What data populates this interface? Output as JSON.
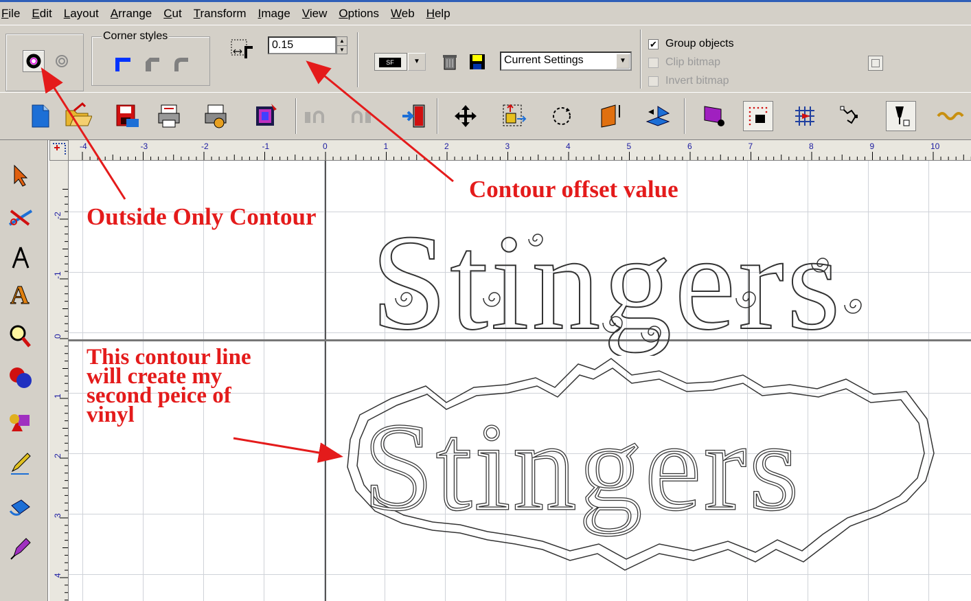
{
  "menu": [
    "File",
    "Edit",
    "Layout",
    "Arrange",
    "Cut",
    "Transform",
    "Image",
    "View",
    "Options",
    "Web",
    "Help"
  ],
  "options_bar": {
    "corner_styles_label": "Corner styles",
    "offset_value": "0.15",
    "font_button": "SF",
    "settings_select": "Current Settings",
    "group_objects_label": "Group objects",
    "group_objects_checked": true,
    "clip_bitmap_label": "Clip bitmap",
    "invert_bitmap_label": "Invert bitmap"
  },
  "toolbar_icons": [
    "new-icon",
    "open-icon",
    "save-icon",
    "print-icon",
    "cut-icon",
    "color-icon",
    "undo-icon",
    "redo-icon",
    "exit-icon",
    "move-icon",
    "size-icon",
    "rotate-icon",
    "slant-icon",
    "mirror-icon",
    "fill-icon",
    "grid-icon",
    "snap-icon",
    "node-icon",
    "pen-icon",
    "weed-icon"
  ],
  "left_tools": [
    "select-icon",
    "knife-icon",
    "compass-icon",
    "text-icon",
    "zoom-icon",
    "shapes-icon",
    "weld-icon",
    "pencil-icon",
    "fill-icon",
    "pen-icon"
  ],
  "ruler": {
    "h_labels": [
      "-4",
      "-3",
      "-2",
      "-1",
      "0",
      "1",
      "2",
      "3",
      "4",
      "5",
      "6",
      "7",
      "8",
      "9",
      "10"
    ],
    "v_labels": [
      "-2",
      "-1",
      "0",
      "1",
      "2",
      "3",
      "4"
    ]
  },
  "annotations": {
    "outside_only": "Outside Only Contour",
    "offset": "Contour offset value",
    "second_piece": [
      "This contour line",
      "will create my",
      "second peice of",
      "vinyl"
    ]
  },
  "canvas": {
    "title_text": "Stingers"
  },
  "colors": {
    "chrome": "#d4d0c8",
    "annotation": "#e41b1b",
    "grid": "#cfd2d8"
  }
}
